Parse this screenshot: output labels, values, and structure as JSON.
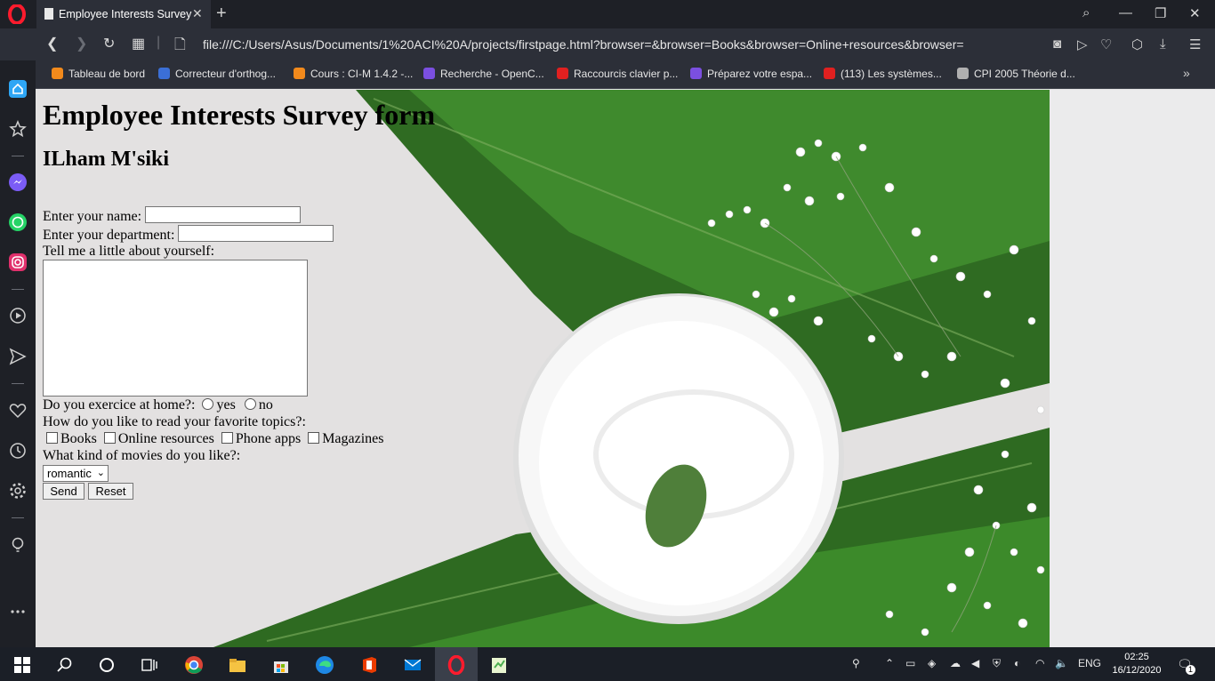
{
  "browser": {
    "tab_title": "Employee Interests Survey",
    "url": "file:///C:/Users/Asus/Documents/1%20ACI%20A/projects/firstpage.html?browser=&browser=Books&browser=Online+resources&browser=",
    "bookmarks": [
      {
        "label": "Tableau de bord",
        "color": "#f28a1c"
      },
      {
        "label": "Correcteur d'orthog...",
        "color": "#3b6fd6"
      },
      {
        "label": "Cours : CI-M 1.4.2 -...",
        "color": "#f28a1c"
      },
      {
        "label": "Recherche - OpenC...",
        "color": "#7b4fe0"
      },
      {
        "label": "Raccourcis clavier p...",
        "color": "#e02020"
      },
      {
        "label": "Préparez votre espa...",
        "color": "#7b4fe0"
      },
      {
        "label": "(113) Les systèmes...",
        "color": "#e02020"
      },
      {
        "label": "CPI 2005 Théorie d...",
        "color": "#b0b0b0"
      }
    ]
  },
  "page": {
    "heading": "Employee Interests Survey form",
    "subheading": "ILham M'siki",
    "name_label": "Enter your name:",
    "department_label": "Enter your department:",
    "about_label": "Tell me a little about yourself:",
    "exercise_label": "Do you exercice at home?:",
    "exercise_options": [
      "yes",
      "no"
    ],
    "read_label": "How do you like to read your favorite topics?:",
    "read_options": [
      "Books",
      "Online resources",
      "Phone apps",
      "Magazines"
    ],
    "movies_label": "What kind of movies do you like?:",
    "movies_selected": "romantic",
    "send_label": "Send",
    "reset_label": "Reset"
  },
  "taskbar": {
    "language": "ENG",
    "time": "02:25",
    "date": "16/12/2020",
    "notification_count": "1"
  }
}
